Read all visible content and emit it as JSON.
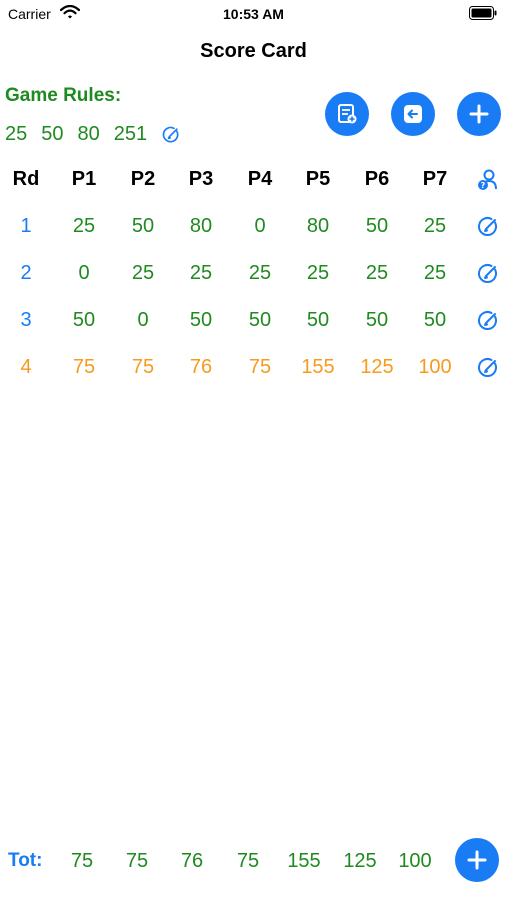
{
  "status_bar": {
    "carrier": "Carrier",
    "time": "10:53 AM"
  },
  "nav": {
    "title": "Score Card"
  },
  "rules": {
    "label": "Game Rules:",
    "values": [
      "25",
      "50",
      "80",
      "251"
    ]
  },
  "buttons": {
    "notes_icon": "notes-add-icon",
    "back_icon": "arrow-left-icon",
    "add_icon": "plus-icon"
  },
  "table": {
    "headers": [
      "Rd",
      "P1",
      "P2",
      "P3",
      "P4",
      "P5",
      "P6",
      "P7"
    ],
    "header_icon": "player-help-icon",
    "rows": [
      {
        "round": "1",
        "scores": [
          "25",
          "50",
          "80",
          "0",
          "80",
          "50",
          "25"
        ],
        "style": "normal"
      },
      {
        "round": "2",
        "scores": [
          "0",
          "25",
          "25",
          "25",
          "25",
          "25",
          "25"
        ],
        "style": "normal"
      },
      {
        "round": "3",
        "scores": [
          "50",
          "0",
          "50",
          "50",
          "50",
          "50",
          "50"
        ],
        "style": "normal"
      },
      {
        "round": "4",
        "scores": [
          "75",
          "75",
          "76",
          "75",
          "155",
          "125",
          "100"
        ],
        "style": "current"
      }
    ],
    "row_icon": "edit-round-icon"
  },
  "totals": {
    "label": "Tot:",
    "values": [
      "75",
      "75",
      "76",
      "75",
      "155",
      "125",
      "100"
    ]
  },
  "colors": {
    "green": "#1f8a1f",
    "blue": "#1a7cf5",
    "orange": "#f79a1d"
  }
}
